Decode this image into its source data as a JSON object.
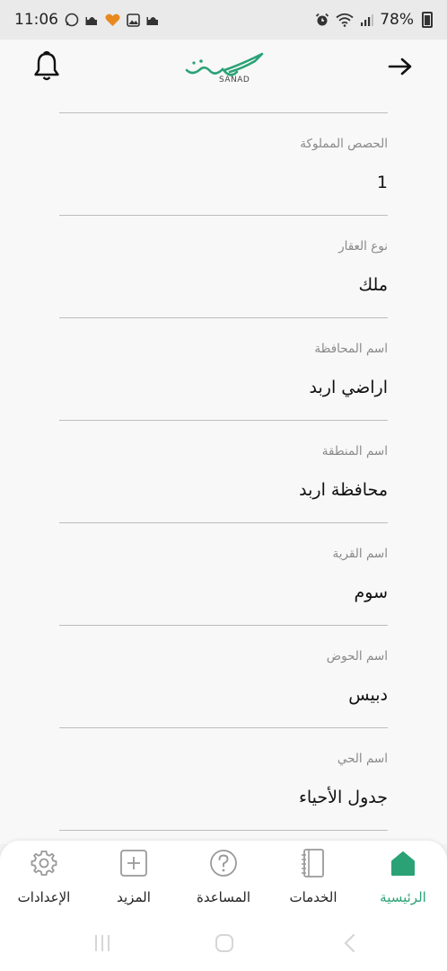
{
  "status_bar": {
    "time": "11:06",
    "battery": "78%",
    "left_icons": [
      "whatsapp-icon",
      "mosque-icon",
      "heart-icon",
      "gallery-icon",
      "mosque-icon"
    ],
    "right_icons": [
      "alarm-icon",
      "wifi-icon",
      "signal-icon",
      "battery-icon"
    ]
  },
  "header": {
    "logo_latin": "SANAD",
    "brand_color": "#2aa276"
  },
  "fields": [
    {
      "label": "الحصص المملوكة",
      "value": "1"
    },
    {
      "label": "نوع العقار",
      "value": "ملك"
    },
    {
      "label": "اسم المحافظة",
      "value": "اراضي اربد"
    },
    {
      "label": "اسم المنطقة",
      "value": "محافظة اربد"
    },
    {
      "label": "اسم القرية",
      "value": "سوم"
    },
    {
      "label": "اسم الحوض",
      "value": "دبيس"
    },
    {
      "label": "اسم الحي",
      "value": "جدول الأحياء"
    }
  ],
  "bottom_nav": {
    "active_color": "#2aa276",
    "items": [
      {
        "label": "الإعدادات",
        "icon": "gear-icon"
      },
      {
        "label": "المزيد",
        "icon": "plus-square-icon"
      },
      {
        "label": "المساعدة",
        "icon": "help-circle-icon"
      },
      {
        "label": "الخدمات",
        "icon": "notebook-icon"
      },
      {
        "label": "الرئيسية",
        "icon": "home-icon",
        "active": true
      }
    ]
  }
}
